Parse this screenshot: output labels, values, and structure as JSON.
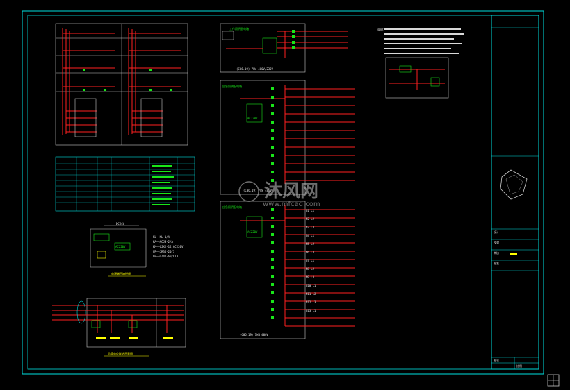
{
  "panels": {
    "top_center_title": "工作照明配电箱",
    "top_center_caption": "(C06.19) 7kW 400V/230V",
    "middle_panel_title": "应急照明配电箱",
    "middle_panel_caption": "(C06.19) 7kW 400V",
    "bottom_panel_title": "应急照明配电箱",
    "bottom_panel_caption": "(C06.19) 7kW 400V",
    "source_caption": "电源端子箱接线",
    "ground_caption": "总等电位联结示意图",
    "voltage_label": "AC220V",
    "dc_label": "DC24V"
  },
  "outgoing_circuits": [
    "N1 L1",
    "N2 L2",
    "N3 L3",
    "N4 L1",
    "N5 L2",
    "N6 L3",
    "N7 L1",
    "N8 L2",
    "N9 L3",
    "N10 L1",
    "N11 L2",
    "N12 L3",
    "N13 L1"
  ],
  "legend_left": [
    "KL——KL-1/A",
    "KA——ACJS-2/A",
    "KM——CJX2-12 AC220V",
    "FR——JR36-20/3",
    "QF——DZ47-60/C10"
  ],
  "notes_title": "说明：",
  "title_block": {
    "rows": [
      "设计",
      "校对",
      "审核",
      "批准"
    ],
    "footer": [
      "图号",
      "比例"
    ]
  },
  "watermark": {
    "brand": "沐风网",
    "url": "www.mfcad.com"
  },
  "colors": {
    "frame": "#00e0e0",
    "wire_red": "#ff2020",
    "text_green": "#19e619",
    "highlight": "#ffff00",
    "background": "#000000"
  }
}
